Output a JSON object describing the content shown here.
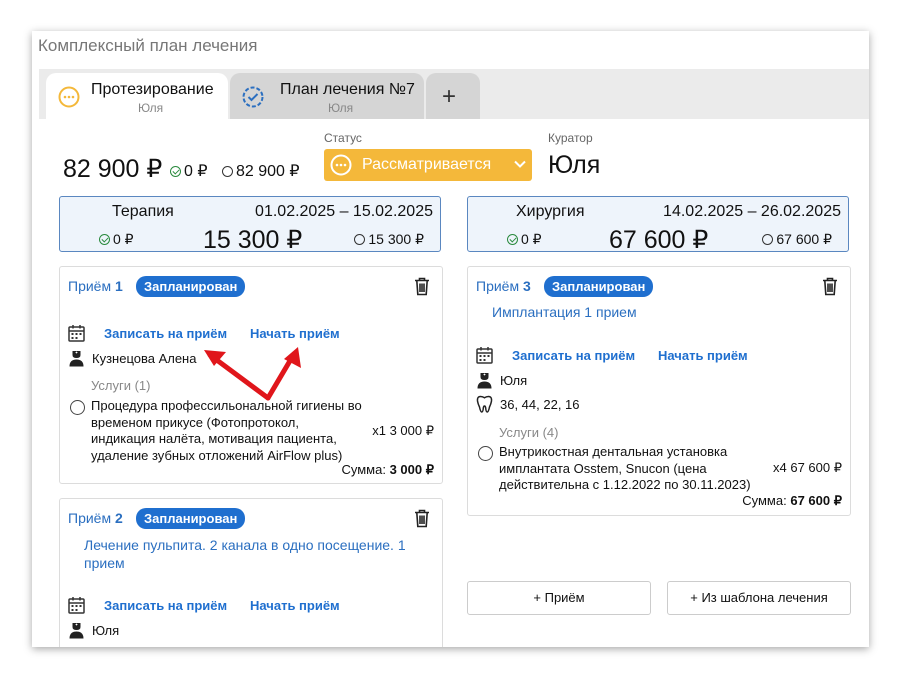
{
  "window": {
    "title": "Комплексный план лечения"
  },
  "tabs": [
    {
      "title": "Протезирование",
      "subtitle": "Юля",
      "icon": "dots-circle-icon",
      "color": "#f4b83a"
    },
    {
      "title": "План лечения №7",
      "subtitle": "Юля",
      "icon": "dashed-check-circle-icon",
      "color": "#2b6fc0"
    },
    {
      "title": "+",
      "icon": "plus-icon"
    }
  ],
  "summary": {
    "total": "82 900 ₽",
    "paid": "0 ₽",
    "unpaid": "82 900 ₽"
  },
  "status": {
    "label": "Статус",
    "value": "Рассматривается",
    "color": "#f4b83a"
  },
  "curator": {
    "label": "Куратор",
    "value": "Юля"
  },
  "phases": [
    {
      "name": "Терапия",
      "dates": "01.02.2025 – 15.02.2025",
      "paid": "0 ₽",
      "total": "15 300 ₽",
      "unpaid": "15 300 ₽"
    },
    {
      "name": "Хирургия",
      "dates": "14.02.2025 – 26.02.2025",
      "paid": "0 ₽",
      "total": "67 600 ₽",
      "unpaid": "67 600 ₽"
    }
  ],
  "visits": [
    {
      "label": "Приём",
      "number": "1",
      "status": "Запланирован",
      "book": "Записать на приём",
      "start": "Начать приём",
      "doctor": "Кузнецова Алена",
      "services_label": "Услуги (1)",
      "service": "Процедура профессильональной гигиены во временом прикусе (Фотопротокол, индикация налёта, мотивация пациента, удаление зубных отложений AirFlow plus)",
      "qty": "x1  3 000 ₽",
      "sum_label": "Сумма:",
      "sum": "3 000 ₽"
    },
    {
      "label": "Приём",
      "number": "3",
      "status": "Запланирован",
      "desc": "Имплантация 1 прием",
      "book": "Записать на приём",
      "start": "Начать приём",
      "doctor": "Юля",
      "teeth": "36, 44, 22, 16",
      "services_label": "Услуги (4)",
      "service": "Внутрикостная дентальная установка имплантата Osstem, Snucon (цена действительна с 1.12.2022 по 30.11.2023)",
      "qty": "x4  67 600 ₽",
      "sum_label": "Сумма:",
      "sum": "67 600 ₽"
    },
    {
      "label": "Приём",
      "number": "2",
      "status": "Запланирован",
      "desc": "Лечение пульпита. 2 канала в одно посещение. 1 прием",
      "book": "Записать на приём",
      "start": "Начать приём",
      "doctor": "Юля"
    }
  ],
  "buttons": {
    "add_visit": "+ Приём",
    "from_template": "+ Из шаблона лечения"
  },
  "colors": {
    "accent": "#1f6fcf",
    "arrow": "#e0161b"
  }
}
